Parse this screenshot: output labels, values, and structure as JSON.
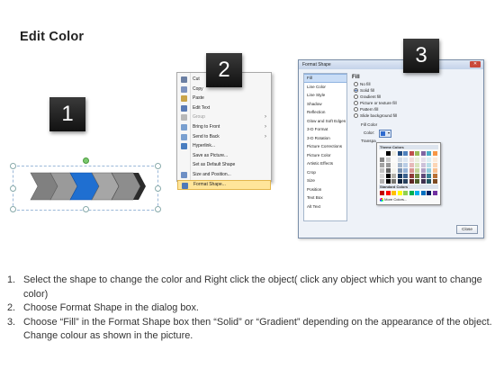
{
  "title": "Edit Color",
  "badges": [
    "1",
    "2",
    "3"
  ],
  "context_menu": {
    "items": [
      {
        "label": "Cut",
        "icon": "scissors-icon",
        "color": "#6b7fa3",
        "disabled": false,
        "submenu": false
      },
      {
        "label": "Copy",
        "icon": "copy-icon",
        "color": "#7d93bf",
        "disabled": false,
        "submenu": false
      },
      {
        "label": "Paste",
        "icon": "paste-icon",
        "color": "#c9a44a",
        "disabled": false,
        "submenu": false
      },
      {
        "label": "Edit Text",
        "icon": "edit-text-icon",
        "color": "#5a7bb5",
        "disabled": false,
        "submenu": false
      },
      {
        "label": "Group",
        "icon": "group-icon",
        "color": "#b8b8b8",
        "disabled": true,
        "submenu": true
      },
      {
        "label": "Bring to Front",
        "icon": "bring-front-icon",
        "color": "#7aa0d0",
        "disabled": false,
        "submenu": true
      },
      {
        "label": "Send to Back",
        "icon": "send-back-icon",
        "color": "#7aa0d0",
        "disabled": false,
        "submenu": true
      },
      {
        "label": "Hyperlink...",
        "icon": "hyperlink-icon",
        "color": "#4a7ec0",
        "disabled": false,
        "submenu": false
      },
      {
        "label": "Save as Picture...",
        "icon": "",
        "color": "",
        "disabled": false,
        "submenu": false
      },
      {
        "label": "Set as Default Shape",
        "icon": "",
        "color": "",
        "disabled": false,
        "submenu": false
      },
      {
        "label": "Size and Position...",
        "icon": "size-position-icon",
        "color": "#6d8fc5",
        "disabled": false,
        "submenu": false
      },
      {
        "label": "Format Shape...",
        "icon": "format-shape-icon",
        "color": "#4f79b8",
        "disabled": false,
        "submenu": false,
        "highlighted": true
      }
    ]
  },
  "format_dialog": {
    "title": "Format Shape",
    "nav_items": [
      "Fill",
      "Line Color",
      "Line Style",
      "Shadow",
      "Reflection",
      "Glow and Soft Edges",
      "3-D Format",
      "3-D Rotation",
      "Picture Corrections",
      "Picture Color",
      "Artistic Effects",
      "Crop",
      "Size",
      "Position",
      "Text Box",
      "Alt Text"
    ],
    "selected_nav": "Fill",
    "fill_heading": "Fill",
    "options": [
      {
        "label": "No fill",
        "selected": false
      },
      {
        "label": "Solid fill",
        "selected": true
      },
      {
        "label": "Gradient fill",
        "selected": false
      },
      {
        "label": "Picture or texture fill",
        "selected": false
      },
      {
        "label": "Pattern fill",
        "selected": false
      },
      {
        "label": "Slide background fill",
        "selected": false
      }
    ],
    "fill_color_label": "Fill Color",
    "color_label": "Color:",
    "transparency_label": "Transpa",
    "close_button": "Close"
  },
  "color_picker": {
    "theme_header": "Theme Colors",
    "standard_header": "Standard Colors",
    "more_colors": "More Colors...",
    "theme_top": [
      "#ffffff",
      "#000000",
      "#eeece1",
      "#1f497d",
      "#4f81bd",
      "#c0504d",
      "#9bbb59",
      "#8064a2",
      "#4bacc6",
      "#f79646"
    ],
    "standard": [
      "#c00000",
      "#ff0000",
      "#ffc000",
      "#ffff00",
      "#92d050",
      "#00b050",
      "#00b0f0",
      "#0070c0",
      "#002060",
      "#7030a0"
    ]
  },
  "instructions": [
    {
      "num": "1.",
      "text": "Select the shape to change the color and Right click the object( click any object which you want to change color)"
    },
    {
      "num": "2.",
      "text": "Choose Format Shape in the dialog box."
    },
    {
      "num": "3.",
      "text": "Choose “Fill” in the Format Shape box then “Solid” or “Gradient” depending on the appearance of the object. Change colour as shown in the picture."
    }
  ],
  "colors": {
    "shape_gray": "#7f7f7f",
    "shape_blue": "#1f6fd1",
    "shape_dark": "#4a4a4a"
  }
}
